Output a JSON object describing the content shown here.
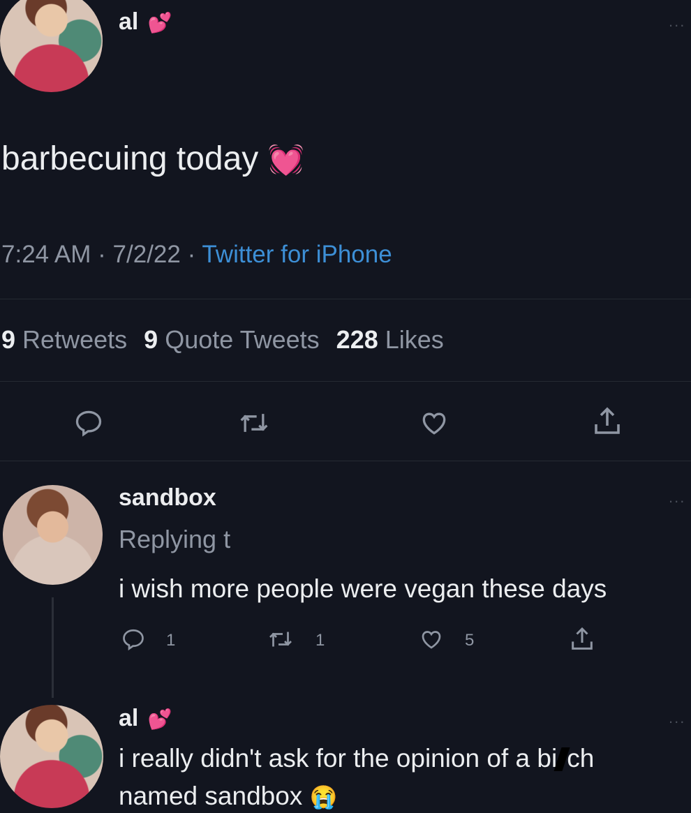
{
  "tweet": {
    "author": "al",
    "author_emoji": "💕",
    "text": "barbecuing today",
    "text_emoji": "💓",
    "time": "7:24 AM",
    "date": "7/2/22",
    "source": "Twitter for iPhone",
    "menu": "...",
    "stats": {
      "retweets_num": "9",
      "retweets_label": "Retweets",
      "quotes_num": "9",
      "quotes_label": "Quote Tweets",
      "likes_num": "228",
      "likes_label": "Likes"
    }
  },
  "replies": [
    {
      "name": "sandbox",
      "replying": "Replying t",
      "text": "i wish more people were vegan these days",
      "reply_count": "1",
      "retweet_count": "1",
      "like_count": "5",
      "menu": "..."
    },
    {
      "name": "al",
      "name_emoji": "💕",
      "text_line1": "i really didn't ask for the opinion of a bi",
      "text_line1_end": "ch",
      "text_line2": "named sandbox",
      "text_emoji": "😭",
      "menu": "..."
    }
  ],
  "icons": {
    "reply": "reply-icon",
    "retweet": "retweet-icon",
    "like": "heart-icon",
    "share": "share-icon"
  },
  "colors": {
    "background": "#12151f",
    "link": "#3d8fd6",
    "heart": "#e0449a"
  }
}
